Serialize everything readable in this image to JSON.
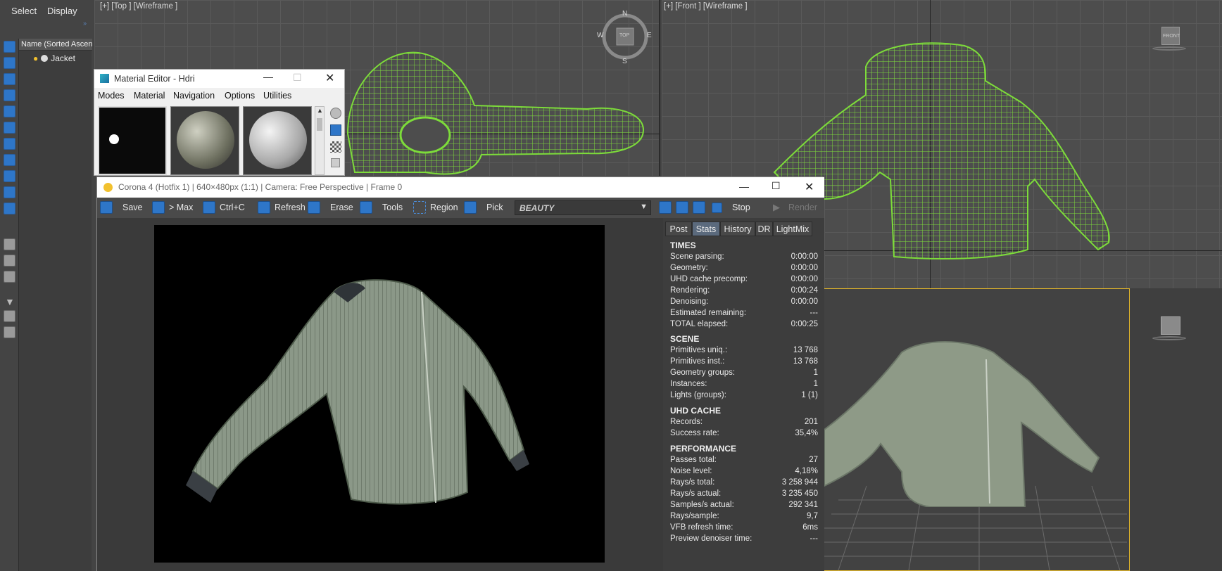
{
  "command_panel": {
    "tabs": [
      "Select",
      "Display"
    ],
    "column_header": "Name (Sorted Ascen",
    "tree_item": "Jacket"
  },
  "viewports": {
    "top_label": "[+] [Top ] [Wireframe ]",
    "front_label": "[+] [Front ] [Wireframe ]",
    "compass": {
      "n": "N",
      "s": "S",
      "e": "E",
      "w": "W",
      "cube": "TOP"
    },
    "front_cube": "FRONT"
  },
  "material_editor": {
    "title": "Material Editor - Hdri",
    "menu": [
      "Modes",
      "Material",
      "Navigation",
      "Options",
      "Utilities"
    ]
  },
  "vfb": {
    "title": "Corona 4 (Hotfix 1) | 640×480px (1:1) | Camera: Free Perspective | Frame 0",
    "toolbar": {
      "save": "Save",
      "to_max": "> Max",
      "copy": "Ctrl+C",
      "refresh": "Refresh",
      "erase": "Erase",
      "tools": "Tools",
      "region": "Region",
      "pick": "Pick",
      "channel": "BEAUTY",
      "stop": "Stop",
      "render": "Render"
    },
    "tabs": [
      "Post",
      "Stats",
      "History",
      "DR",
      "LightMix"
    ],
    "active_tab": "Stats",
    "stats": {
      "times": {
        "heading": "TIMES",
        "rows": [
          {
            "k": "Scene parsing:",
            "v": "0:00:00"
          },
          {
            "k": "Geometry:",
            "v": "0:00:00"
          },
          {
            "k": "UHD cache precomp:",
            "v": "0:00:00"
          },
          {
            "k": "Rendering:",
            "v": "0:00:24"
          },
          {
            "k": "Denoising:",
            "v": "0:00:00"
          },
          {
            "k": "Estimated remaining:",
            "v": "---"
          },
          {
            "k": "TOTAL elapsed:",
            "v": "0:00:25"
          }
        ]
      },
      "scene": {
        "heading": "SCENE",
        "rows": [
          {
            "k": "Primitives uniq.:",
            "v": "13 768"
          },
          {
            "k": "Primitives inst.:",
            "v": "13 768"
          },
          {
            "k": "Geometry groups:",
            "v": "1"
          },
          {
            "k": "Instances:",
            "v": "1"
          },
          {
            "k": "Lights (groups):",
            "v": "1 (1)"
          }
        ]
      },
      "uhd": {
        "heading": "UHD CACHE",
        "rows": [
          {
            "k": "Records:",
            "v": "201"
          },
          {
            "k": "Success rate:",
            "v": "35,4%"
          }
        ]
      },
      "perf": {
        "heading": "PERFORMANCE",
        "rows": [
          {
            "k": "Passes total:",
            "v": "27"
          },
          {
            "k": "Noise level:",
            "v": "4,18%"
          },
          {
            "k": "Rays/s total:",
            "v": "3 258 944"
          },
          {
            "k": "Rays/s actual:",
            "v": "3 235 450"
          },
          {
            "k": "Samples/s actual:",
            "v": "292 341"
          },
          {
            "k": "Rays/sample:",
            "v": "9,7"
          },
          {
            "k": "VFB refresh time:",
            "v": "6ms"
          },
          {
            "k": "Preview denoiser time:",
            "v": "---"
          }
        ]
      }
    }
  },
  "colors": {
    "wireframe": "#7ddc3a",
    "accent_blue": "#2e76c8",
    "active_tab": "#5b6a7d",
    "jacket": "#8a9886"
  }
}
